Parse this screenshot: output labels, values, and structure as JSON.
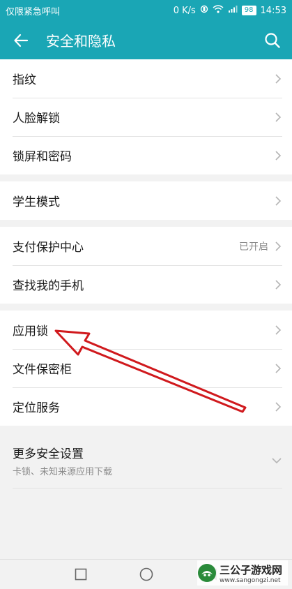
{
  "status_bar": {
    "left_text": "仅限紧急呼叫",
    "net_speed": "0 K/s",
    "battery": "98",
    "time": "14:53"
  },
  "app_bar": {
    "title": "安全和隐私",
    "back_icon": "back-arrow-icon",
    "search_icon": "search-icon"
  },
  "colors": {
    "accent": "#1aa6b5",
    "annotation_arrow": "#d0191d"
  },
  "groups": [
    {
      "items": [
        {
          "label": "指纹"
        },
        {
          "label": "人脸解锁"
        },
        {
          "label": "锁屏和密码"
        }
      ]
    },
    {
      "items": [
        {
          "label": "学生模式"
        }
      ]
    },
    {
      "items": [
        {
          "label": "支付保护中心",
          "value": "已开启"
        },
        {
          "label": "查找我的手机"
        }
      ]
    },
    {
      "items": [
        {
          "label": "应用锁"
        },
        {
          "label": "文件保密柜"
        },
        {
          "label": "定位服务"
        }
      ]
    }
  ],
  "more_settings": {
    "label": "更多安全设置",
    "subtitle": "卡锁、未知来源应用下载"
  },
  "nav_bar": {
    "icons": [
      "recents-square-icon",
      "home-circle-icon",
      "back-triangle-icon"
    ]
  },
  "watermark": {
    "name": "三公子游戏网",
    "url": "www.sangongzi.net"
  }
}
